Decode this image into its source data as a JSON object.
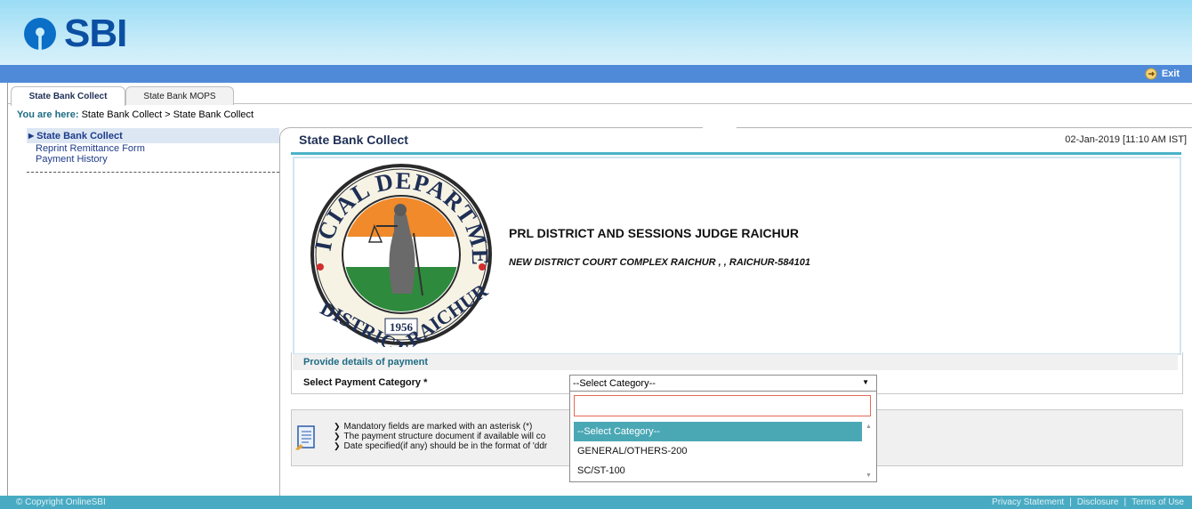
{
  "brand": {
    "logo_text": "SBI",
    "color": "#0b4fa3"
  },
  "header": {
    "exit_label": "Exit"
  },
  "tabs": [
    {
      "label": "State Bank Collect",
      "active": true
    },
    {
      "label": "State Bank MOPS",
      "active": false
    }
  ],
  "breadcrumb": {
    "label": "You are here:",
    "path": "State Bank Collect > State Bank Collect"
  },
  "sidebar": {
    "active_item": "State Bank Collect",
    "items": [
      "Reprint Remittance Form",
      "Payment History"
    ]
  },
  "panel": {
    "title": "State Bank Collect",
    "datetime": "02-Jan-2019 [11:10 AM IST]"
  },
  "department": {
    "emblem_top": "JUDICIAL DEPARTMENT",
    "emblem_bottom_left": "DISTRICT",
    "emblem_year": "1956",
    "emblem_bottom_right": "RAICHUR",
    "name": "PRL DISTRICT AND SESSIONS JUDGE RAICHUR",
    "address": "NEW DISTRICT COURT COMPLEX RAICHUR , , RAICHUR-584101"
  },
  "form": {
    "section_label": "Provide details of payment",
    "category_label": "Select Payment Category *",
    "category_selected": "--Select Category--",
    "search_value": "",
    "options": [
      "--Select Category--",
      "GENERAL/OTHERS-200",
      "SC/ST-100"
    ]
  },
  "notes": [
    "Mandatory fields are marked with an asterisk (*)",
    "The payment structure document if available will co",
    "Date specified(if any) should be in the format of 'ddr"
  ],
  "footer": {
    "copyright": "© Copyright OnlineSBI",
    "links": [
      "Privacy Statement",
      "Disclosure",
      "Terms of Use"
    ]
  },
  "colors": {
    "header_gradient_top": "#9adcf5",
    "blue_bar": "#4f8ad9",
    "teal": "#4bb2c8",
    "footer": "#49abc3",
    "selected_option": "#4aa8b5"
  }
}
